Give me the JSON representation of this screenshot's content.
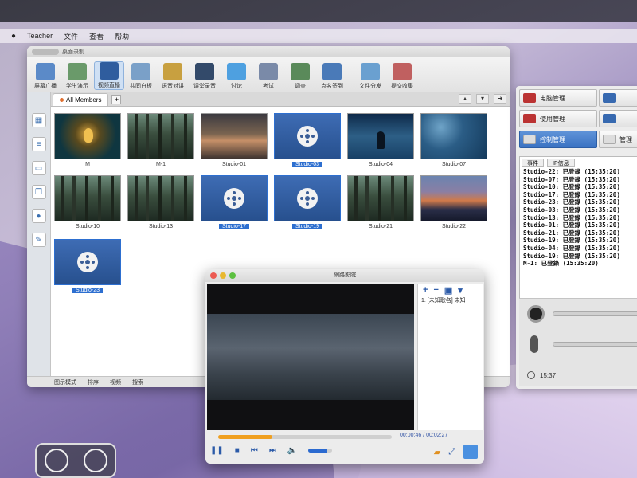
{
  "menubar": {
    "apple": "",
    "items": [
      "Teacher",
      "文件",
      "查看",
      "帮助"
    ]
  },
  "app": {
    "title": "桌面录制",
    "toolbar": [
      {
        "label": "屏幕广播",
        "icon": "monitor-broadcast-icon",
        "color": "#5b8ac8"
      },
      {
        "label": "学生演示",
        "icon": "student-demo-icon",
        "color": "#6a9a6a"
      },
      {
        "label": "视频直播",
        "icon": "video-live-icon",
        "color": "#2f5d9e",
        "active": true
      },
      {
        "label": "共同白板",
        "icon": "whiteboard-icon",
        "color": "#7aa0c8"
      },
      {
        "label": "语音对讲",
        "icon": "microphone-icon",
        "color": "#c8a040"
      },
      {
        "label": "课堂录音",
        "icon": "recorder-icon",
        "color": "#334a6a"
      },
      {
        "label": "讨论",
        "icon": "discussion-icon",
        "color": "#4ea0e0"
      },
      {
        "label": "考试",
        "icon": "exam-clock-icon",
        "color": "#7a8aa8"
      },
      {
        "label": "调查",
        "icon": "survey-icon",
        "color": "#5a8a5a"
      },
      {
        "label": "点名签到",
        "icon": "roll-call-icon",
        "color": "#4a7ab8"
      },
      {
        "label": "文件分发",
        "icon": "file-distribute-icon",
        "color": "#6aa0d0"
      },
      {
        "label": "提交收集",
        "icon": "file-collect-icon",
        "color": "#c06060"
      }
    ],
    "tab": "All Members",
    "thumbnails": [
      {
        "label": "M",
        "kind": "bird",
        "selected": false
      },
      {
        "label": "M-1",
        "kind": "forest",
        "selected": false
      },
      {
        "label": "Studio-01",
        "kind": "dusk1",
        "selected": false
      },
      {
        "label": "Studio-03",
        "kind": "video",
        "selected": true
      },
      {
        "label": "Studio-04",
        "kind": "seat",
        "selected": false
      },
      {
        "label": "Studio-07",
        "kind": "water",
        "selected": false
      },
      {
        "label": "Studio-10",
        "kind": "forest",
        "selected": false
      },
      {
        "label": "Studio-13",
        "kind": "forest",
        "selected": false
      },
      {
        "label": "Studio-17",
        "kind": "video",
        "selected": true
      },
      {
        "label": "Studio-19",
        "kind": "video",
        "selected": true
      },
      {
        "label": "Studio-21",
        "kind": "forest",
        "selected": false
      },
      {
        "label": "Studio-22",
        "kind": "sunset",
        "selected": false
      },
      {
        "label": "Studio-23",
        "kind": "video",
        "selected": true
      }
    ],
    "status": [
      "图示模式",
      "排序",
      "视频",
      "搜索"
    ]
  },
  "right_panel": {
    "buttons": [
      {
        "label": "电脑管理",
        "active": false,
        "mini": "r"
      },
      {
        "label": "",
        "active": false,
        "mini": "b"
      },
      {
        "label": "使用管理",
        "active": false,
        "mini": "r"
      },
      {
        "label": "",
        "active": false,
        "mini": "b"
      },
      {
        "label": "控制管理",
        "active": true,
        "mini": "w"
      },
      {
        "label": "管理",
        "active": false,
        "mini": "w"
      }
    ],
    "log_tabs": [
      "事件",
      "IP信息"
    ],
    "log": [
      "Studio-22: 已登錄 (15:35:20)",
      "Studio-07: 已登錄 (15:35:20)",
      "Studio-10: 已登錄 (15:35:20)",
      "Studio-17: 已登錄 (15:35:20)",
      "Studio-23: 已登錄 (15:35:20)",
      "Studio-03: 已登錄 (15:35:20)",
      "Studio-13: 已登錄 (15:35:20)",
      "Studio-01: 已登錄 (15:35:20)",
      "Studio-21: 已登錄 (15:35:20)",
      "Studio-19: 已登錄 (15:35:20)",
      "Studio-04: 已登錄 (15:35:20)",
      "Studio-19: 已登錄 (15:35:20)",
      "M-1: 已登錄 (15:35:20)"
    ],
    "mic_level": 0.0,
    "speaker_level": 0.0,
    "clock": "15:37"
  },
  "player": {
    "title": "網路影院",
    "playlist_tools": [
      "+",
      "−",
      "▣",
      "▾"
    ],
    "playlist_item": "1. [未知歌名]  未知",
    "time": "00:00:46 / 00:02:27",
    "progress": 0.31,
    "volume": 0.8
  },
  "colors": {
    "accent": "#2d6fd0",
    "progress": "#f0a020"
  }
}
